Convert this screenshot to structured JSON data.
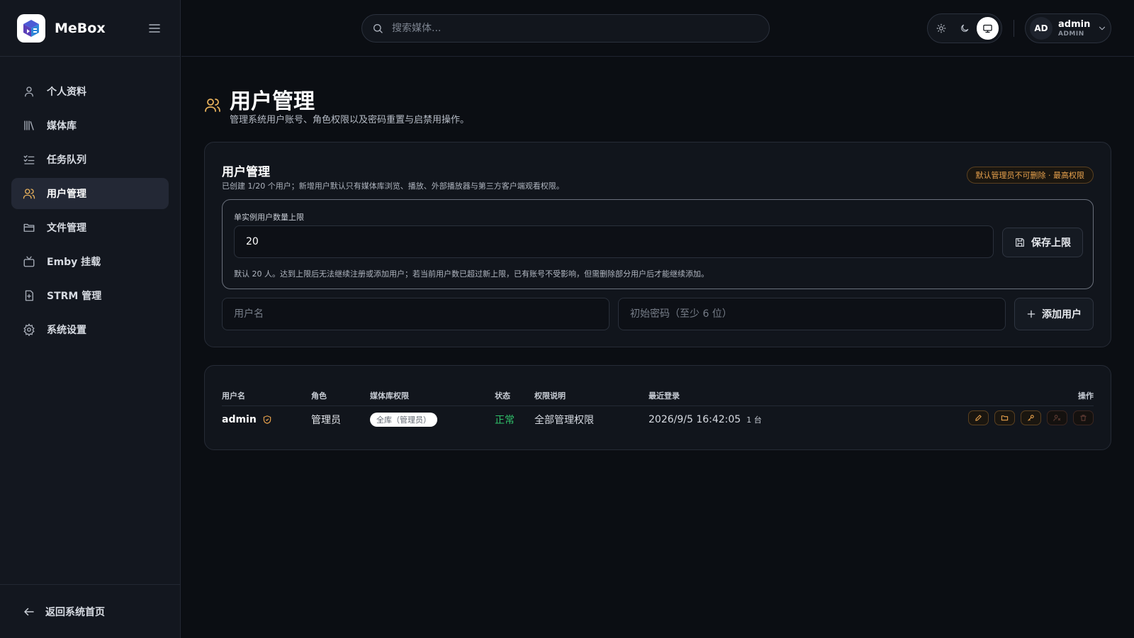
{
  "app": {
    "name": "MeBox"
  },
  "sidebar": {
    "items": [
      {
        "label": "个人资料",
        "icon": "user-icon",
        "active": false
      },
      {
        "label": "媒体库",
        "icon": "library-icon",
        "active": false
      },
      {
        "label": "任务队列",
        "icon": "task-list-icon",
        "active": false
      },
      {
        "label": "用户管理",
        "icon": "users-icon",
        "active": true
      },
      {
        "label": "文件管理",
        "icon": "folder-icon",
        "active": false
      },
      {
        "label": "Emby 挂载",
        "icon": "tv-icon",
        "active": false
      },
      {
        "label": "STRM 管理",
        "icon": "file-link-icon",
        "active": false
      },
      {
        "label": "系统设置",
        "icon": "gear-icon",
        "active": false
      }
    ],
    "back_label": "返回系统首页"
  },
  "topbar": {
    "search_placeholder": "搜索媒体...",
    "theme_modes": [
      "light",
      "dark",
      "system"
    ],
    "theme_active": "system",
    "user": {
      "initials": "AD",
      "name": "admin",
      "role": "ADMIN"
    }
  },
  "page": {
    "title": "用户管理",
    "subtitle": "管理系统用户账号、角色权限以及密码重置与启禁用操作。"
  },
  "manage_card": {
    "title": "用户管理",
    "description": "已创建 1/20 个用户；新增用户默认只有媒体库浏览、播放、外部播放器与第三方客户端观看权限。",
    "badge": "默认管理员不可删除 · 最高权限",
    "limit": {
      "label": "单实例用户数量上限",
      "value": "20",
      "save_label": "保存上限",
      "note": "默认 20 人。达到上限后无法继续注册或添加用户；若当前用户数已超过新上限，已有账号不受影响，但需删除部分用户后才能继续添加。"
    },
    "add": {
      "username_placeholder": "用户名",
      "password_placeholder": "初始密码（至少 6 位）",
      "button_label": "添加用户"
    }
  },
  "users_table": {
    "headers": {
      "username": "用户名",
      "role": "角色",
      "library": "媒体库权限",
      "status": "状态",
      "permission": "权限说明",
      "last_login": "最近登录",
      "actions": "操作"
    },
    "rows": [
      {
        "username": "admin",
        "role": "管理员",
        "library": "全库（管理员）",
        "status": "正常",
        "permission": "全部管理权限",
        "last_login": "2026/9/5 16:42:05",
        "devices": "1 台"
      }
    ]
  },
  "colors": {
    "accent": "#e7a14c",
    "success": "#30c26a",
    "background": "#0b0e13",
    "sidebar": "#13171f"
  }
}
